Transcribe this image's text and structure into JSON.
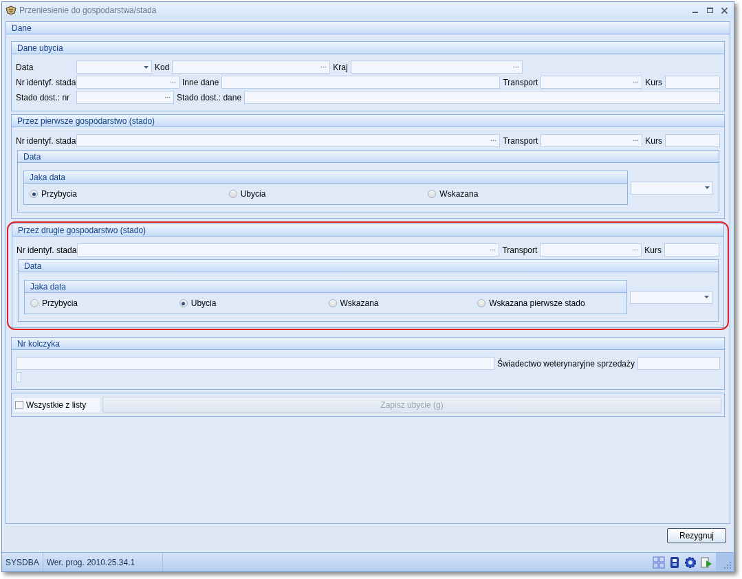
{
  "window": {
    "title": "Przeniesienie do gospodarstwa/stada"
  },
  "dane": {
    "title": "Dane",
    "dane_ubycia": {
      "title": "Dane ubycia",
      "data_label": "Data",
      "kod_label": "Kod",
      "kraj_label": "Kraj",
      "nr_label": "Nr identyf. stada",
      "inne_label": "Inne dane",
      "transport_label": "Transport",
      "kurs_label": "Kurs",
      "stado_nr_label": "Stado dost.: nr",
      "stado_dane_label": "Stado dost.: dane"
    },
    "herds": [
      {
        "title": "Przez pierwsze gospodarstwo (stado)",
        "highlighted": false,
        "nr_label": "Nr identyf. stada",
        "transport_label": "Transport",
        "kurs_label": "Kurs",
        "data_title": "Data",
        "jaka_data_title": "Jaka data",
        "options": [
          {
            "label": "Przybycia",
            "selected": true
          },
          {
            "label": "Ubycia",
            "selected": false
          },
          {
            "label": "Wskazana",
            "selected": false
          }
        ]
      },
      {
        "title": "Przez drugie gospodarstwo (stado)",
        "highlighted": true,
        "nr_label": "Nr identyf. stada",
        "transport_label": "Transport",
        "kurs_label": "Kurs",
        "data_title": "Data",
        "jaka_data_title": "Jaka data",
        "options": [
          {
            "label": "Przybycia",
            "selected": false
          },
          {
            "label": "Ubycia",
            "selected": true
          },
          {
            "label": "Wskazana",
            "selected": false
          },
          {
            "label": "Wskazana pierwsze stado",
            "selected": false
          }
        ]
      }
    ],
    "nr_kolczyka": {
      "title": "Nr kolczyka",
      "certificate_label": "Świadectwo weterynaryjne sprzedaży"
    },
    "all_from_list": {
      "label": "Wszystkie z listy",
      "checked": false
    },
    "save_button": {
      "label": "Zapisz ubycie (g)",
      "disabled": true
    }
  },
  "cancel_button": "Rezygnuj",
  "status_bar": [
    "SYSDBA",
    "Wer. prog. 2010.25.34.1"
  ]
}
